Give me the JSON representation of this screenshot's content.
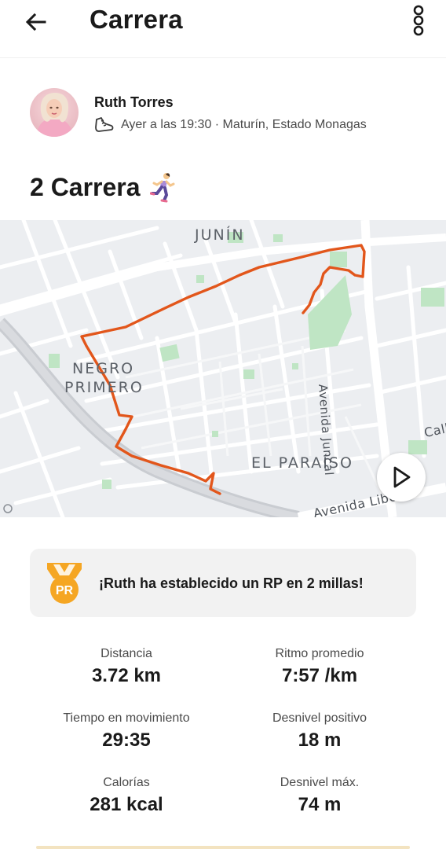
{
  "header": {
    "title": "Carrera",
    "back_icon": "arrow-left-icon",
    "more_icon": "more-vertical-icon"
  },
  "author": {
    "name": "Ruth Torres",
    "meta": "Ayer a las 19:30 · Maturín, Estado Monagas",
    "activity_icon": "running-shoe-icon"
  },
  "activity": {
    "title": "2 Carrera",
    "emoji": "woman-running-icon"
  },
  "map": {
    "labels": {
      "junin": "JUNÍN",
      "negro": "NEGRO",
      "primero": "PRIMERO",
      "el_paraiso": "EL PARAÍSO",
      "avenida_juncal": "Avenida Juncal",
      "avenida_libertador": "Avenida Liber",
      "calle_partial": "Call"
    },
    "route_color": "#e2561b",
    "play_icon": "play-icon"
  },
  "pr": {
    "badge_text": "PR",
    "message": "¡Ruth ha establecido un RP en 2 millas!",
    "badge_color": "#f5a623"
  },
  "stats": [
    {
      "label": "Distancia",
      "value": "3.72 km"
    },
    {
      "label": "Ritmo promedio",
      "value": "7:57 /km"
    },
    {
      "label": "Tiempo en movimiento",
      "value": "29:35"
    },
    {
      "label": "Desnivel positivo",
      "value": "18 m"
    },
    {
      "label": "Calorías",
      "value": "281 kcal"
    },
    {
      "label": "Desnivel máx.",
      "value": "74 m"
    }
  ]
}
